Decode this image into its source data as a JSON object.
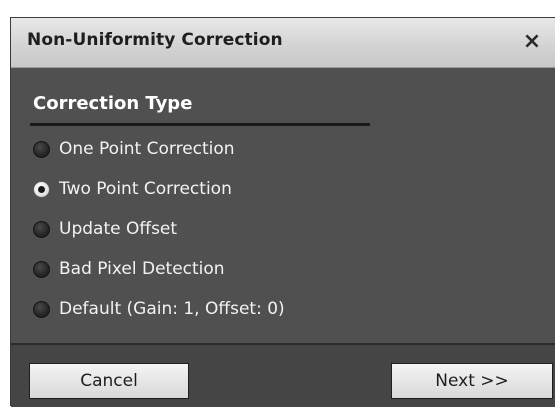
{
  "dialog": {
    "title": "Non-Uniformity Correction",
    "close_glyph": "×"
  },
  "section": {
    "header": "Correction Type"
  },
  "options": [
    {
      "label": "One Point Correction",
      "selected": false
    },
    {
      "label": "Two Point Correction",
      "selected": true
    },
    {
      "label": "Update Offset",
      "selected": false
    },
    {
      "label": "Bad Pixel Detection",
      "selected": false
    },
    {
      "label": "Default (Gain: 1, Offset: 0)",
      "selected": false
    }
  ],
  "footer": {
    "cancel_label": "Cancel",
    "next_label": "Next >>"
  },
  "colors": {
    "panel_bg": "#505050",
    "titlebar_bg": "#d4d4d4",
    "text": "#f2f2f2"
  },
  "icons": {
    "close": "close-icon",
    "radio": "radio-button-icon"
  }
}
